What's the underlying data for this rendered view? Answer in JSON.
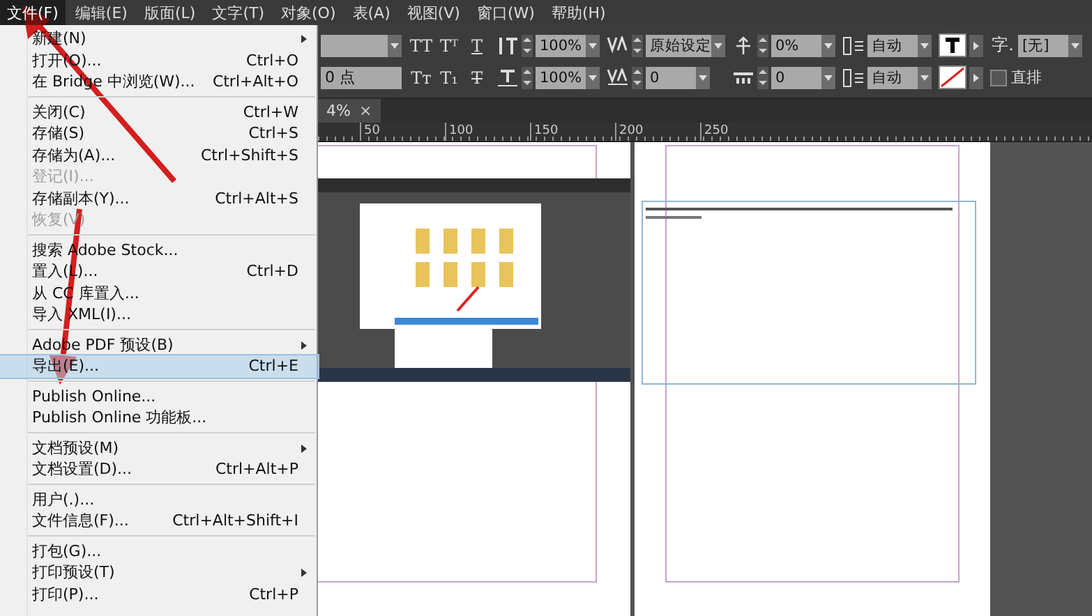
{
  "menubar": [
    {
      "label": "文件(F)",
      "selected": true
    },
    {
      "label": "编辑(E)",
      "selected": false
    },
    {
      "label": "版面(L)",
      "selected": false
    },
    {
      "label": "文字(T)",
      "selected": false
    },
    {
      "label": "对象(O)",
      "selected": false
    },
    {
      "label": "表(A)",
      "selected": false
    },
    {
      "label": "视图(V)",
      "selected": false
    },
    {
      "label": "窗口(W)",
      "selected": false
    },
    {
      "label": "帮助(H)",
      "selected": false
    }
  ],
  "file_menu": [
    {
      "kind": "item",
      "label": "新建(N)",
      "submenu": true,
      "disabled": false,
      "selected": false
    },
    {
      "kind": "item",
      "label": "打开(O)...",
      "shortcut": "Ctrl+O",
      "submenu": false,
      "disabled": false,
      "selected": false
    },
    {
      "kind": "item",
      "label": "在 Bridge 中浏览(W)...",
      "shortcut": "Ctrl+Alt+O",
      "submenu": false,
      "disabled": false,
      "selected": false
    },
    {
      "kind": "separator"
    },
    {
      "kind": "item",
      "label": "关闭(C)",
      "shortcut": "Ctrl+W",
      "submenu": false,
      "disabled": false,
      "selected": false
    },
    {
      "kind": "item",
      "label": "存储(S)",
      "shortcut": "Ctrl+S",
      "submenu": false,
      "disabled": false,
      "selected": false
    },
    {
      "kind": "item",
      "label": "存储为(A)...",
      "shortcut": "Ctrl+Shift+S",
      "submenu": false,
      "disabled": false,
      "selected": false
    },
    {
      "kind": "item",
      "label": "登记(I)...",
      "submenu": false,
      "disabled": true,
      "selected": false
    },
    {
      "kind": "item",
      "label": "存储副本(Y)...",
      "shortcut": "Ctrl+Alt+S",
      "submenu": false,
      "disabled": false,
      "selected": false
    },
    {
      "kind": "item",
      "label": "恢复(V)",
      "submenu": false,
      "disabled": true,
      "selected": false
    },
    {
      "kind": "separator"
    },
    {
      "kind": "item",
      "label": "搜索 Adobe Stock...",
      "submenu": false,
      "disabled": false,
      "selected": false
    },
    {
      "kind": "item",
      "label": "置入(L)...",
      "shortcut": "Ctrl+D",
      "submenu": false,
      "disabled": false,
      "selected": false
    },
    {
      "kind": "item",
      "label": "从 CC 库置入...",
      "submenu": false,
      "disabled": false,
      "selected": false
    },
    {
      "kind": "item",
      "label": "导入 XML(I)...",
      "submenu": false,
      "disabled": false,
      "selected": false
    },
    {
      "kind": "separator"
    },
    {
      "kind": "item",
      "label": "Adobe PDF 预设(B)",
      "submenu": true,
      "disabled": false,
      "selected": false
    },
    {
      "kind": "item",
      "label": "导出(E)...",
      "shortcut": "Ctrl+E",
      "submenu": false,
      "disabled": false,
      "selected": true
    },
    {
      "kind": "separator"
    },
    {
      "kind": "item",
      "label": "Publish Online...",
      "submenu": false,
      "disabled": false,
      "selected": false
    },
    {
      "kind": "item",
      "label": "Publish Online 功能板...",
      "submenu": false,
      "disabled": false,
      "selected": false
    },
    {
      "kind": "separator"
    },
    {
      "kind": "item",
      "label": "文档预设(M)",
      "submenu": true,
      "disabled": false,
      "selected": false
    },
    {
      "kind": "item",
      "label": "文档设置(D)...",
      "shortcut": "Ctrl+Alt+P",
      "submenu": false,
      "disabled": false,
      "selected": false
    },
    {
      "kind": "separator"
    },
    {
      "kind": "item",
      "label": "用户(.)...",
      "submenu": false,
      "disabled": false,
      "selected": false
    },
    {
      "kind": "item",
      "label": "文件信息(F)...",
      "shortcut": "Ctrl+Alt+Shift+I",
      "submenu": false,
      "disabled": false,
      "selected": false
    },
    {
      "kind": "separator"
    },
    {
      "kind": "item",
      "label": "打包(G)...",
      "submenu": false,
      "disabled": false,
      "selected": false
    },
    {
      "kind": "item",
      "label": "打印预设(T)",
      "submenu": true,
      "disabled": false,
      "selected": false
    },
    {
      "kind": "item",
      "label": "打印(P)...",
      "shortcut": "Ctrl+P",
      "submenu": false,
      "disabled": false,
      "selected": false
    }
  ],
  "toolbar": [
    {
      "top": [
        {
          "kind": "font-dropdown"
        }
      ],
      "bottom": [
        {
          "kind": "field",
          "value": "0 点"
        }
      ]
    },
    {
      "top": [
        {
          "kind": "glyph",
          "text": "TT"
        },
        {
          "kind": "glyph",
          "text": "Tᵀ"
        },
        {
          "kind": "underline-glyph",
          "text": "T"
        }
      ],
      "bottom": [
        {
          "kind": "glyph",
          "text": "Tт"
        },
        {
          "kind": "glyph",
          "text": "T₁"
        },
        {
          "kind": "strike-glyph",
          "text": "T"
        }
      ]
    },
    {
      "top": [
        {
          "kind": "leading-icon"
        },
        {
          "kind": "spin"
        },
        {
          "kind": "dropdown",
          "value": "100%"
        }
      ],
      "bottom": [
        {
          "kind": "scale-icon"
        },
        {
          "kind": "spin"
        },
        {
          "kind": "dropdown",
          "value": "100%"
        }
      ]
    },
    {
      "top": [
        {
          "kind": "kerning-icon"
        },
        {
          "kind": "spin"
        },
        {
          "kind": "dropdown",
          "value": "原始设定"
        }
      ],
      "bottom": [
        {
          "kind": "tracking-icon"
        },
        {
          "kind": "spin"
        },
        {
          "kind": "dropdown",
          "value": "0"
        }
      ]
    },
    {
      "top": [
        {
          "kind": "baseline-icon"
        },
        {
          "kind": "spin"
        },
        {
          "kind": "dropdown",
          "value": "0%"
        }
      ],
      "bottom": [
        {
          "kind": "spacing-icon"
        },
        {
          "kind": "spin"
        },
        {
          "kind": "dropdown",
          "value": "0"
        }
      ]
    },
    {
      "top": [
        {
          "kind": "column-icon"
        },
        {
          "kind": "dropdown",
          "value": "自动"
        }
      ],
      "bottom": [
        {
          "kind": "column-icon"
        },
        {
          "kind": "dropdown",
          "value": "自动"
        }
      ]
    },
    {
      "top": [
        {
          "kind": "fill-swatch"
        },
        {
          "kind": "menu-arrow"
        }
      ],
      "bottom": [
        {
          "kind": "stroke-swatch"
        },
        {
          "kind": "menu-arrow"
        }
      ]
    },
    {
      "top": [
        {
          "kind": "glyph",
          "text": "字."
        },
        {
          "kind": "dropdown",
          "value": "[无]"
        }
      ],
      "bottom": [
        {
          "kind": "checkbox",
          "label": "直排",
          "checked": false
        }
      ]
    }
  ],
  "document_tab": {
    "label": "4%",
    "close": "×"
  },
  "ruler": [
    "50",
    "100",
    "150",
    "200",
    "250"
  ]
}
